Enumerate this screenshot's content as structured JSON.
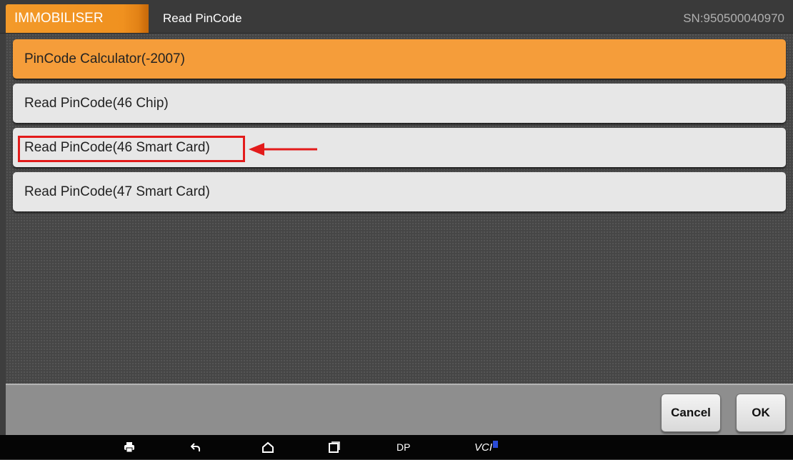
{
  "header": {
    "module_tab": "IMMOBILISER",
    "page_title": "Read PinCode",
    "serial_number": "SN:950500040970"
  },
  "menu": {
    "items": [
      {
        "label": "PinCode Calculator(-2007)",
        "selected": true
      },
      {
        "label": "Read PinCode(46 Chip)",
        "selected": false
      },
      {
        "label": "Read PinCode(46 Smart Card)",
        "selected": false,
        "annotated": true
      },
      {
        "label": "Read PinCode(47 Smart Card)",
        "selected": false
      }
    ]
  },
  "actions": {
    "cancel_label": "Cancel",
    "ok_label": "OK"
  },
  "nav_bar": {
    "icons": [
      "print-icon",
      "back-icon",
      "home-icon",
      "recent-apps-icon"
    ],
    "dp_label": "DP",
    "vci_label": "VCI"
  },
  "colors": {
    "accent": "#f59d3a",
    "annotation": "#e31b1b",
    "bluetooth": "#2a4bd8"
  }
}
